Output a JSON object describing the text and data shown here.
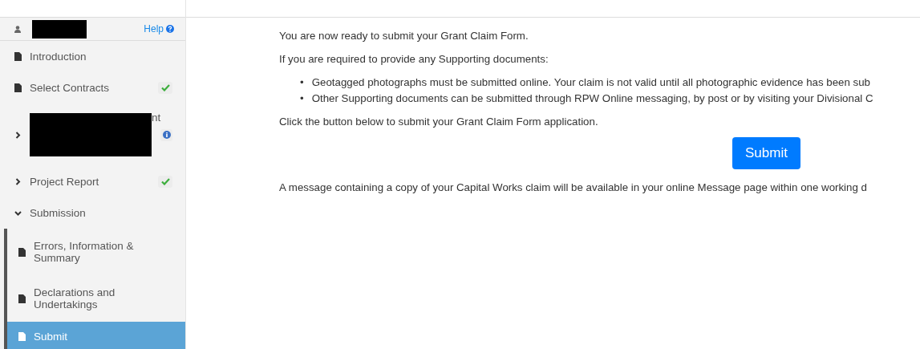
{
  "sidebar": {
    "help_link": "Help",
    "items": [
      {
        "kind": "page",
        "label": "Introduction",
        "selected": false,
        "complete": false,
        "info": false
      },
      {
        "kind": "page",
        "label": "Select Contracts",
        "selected": false,
        "complete": true,
        "info": false
      },
      {
        "kind": "group",
        "label": "nt",
        "redacted": true,
        "expanded": false,
        "complete": false,
        "info": true
      },
      {
        "kind": "group",
        "label": "Project Report",
        "expanded": false,
        "complete": true,
        "info": false
      },
      {
        "kind": "group",
        "label": "Submission",
        "expanded": true,
        "complete": false,
        "info": false,
        "children": [
          {
            "kind": "page",
            "label": "Errors, Information & Summary",
            "selected": false,
            "complete": false,
            "info": false
          },
          {
            "kind": "page",
            "label": "Declarations and Undertakings",
            "selected": false,
            "complete": false,
            "info": false
          },
          {
            "kind": "page",
            "label": "Submit",
            "selected": true,
            "complete": false,
            "info": false
          }
        ]
      }
    ]
  },
  "main": {
    "intro": "You are now ready to submit your Grant Claim Form.",
    "supporting_heading": "If you are required to provide any Supporting documents:",
    "bullets": [
      {
        "marker": "•",
        "text": "Geotagged photographs must be submitted online. Your claim is not valid until all photographic evidence has been sub"
      },
      {
        "marker": "•",
        "text": "Other Supporting documents can be submitted through RPW Online messaging, by post or by visiting your Divisional C"
      }
    ],
    "instruction": "Click the button below to submit your Grant Claim Form application.",
    "submit_button": "Submit",
    "note": "A message containing a copy of your Capital Works claim will be available in your online Message page within one working d"
  }
}
